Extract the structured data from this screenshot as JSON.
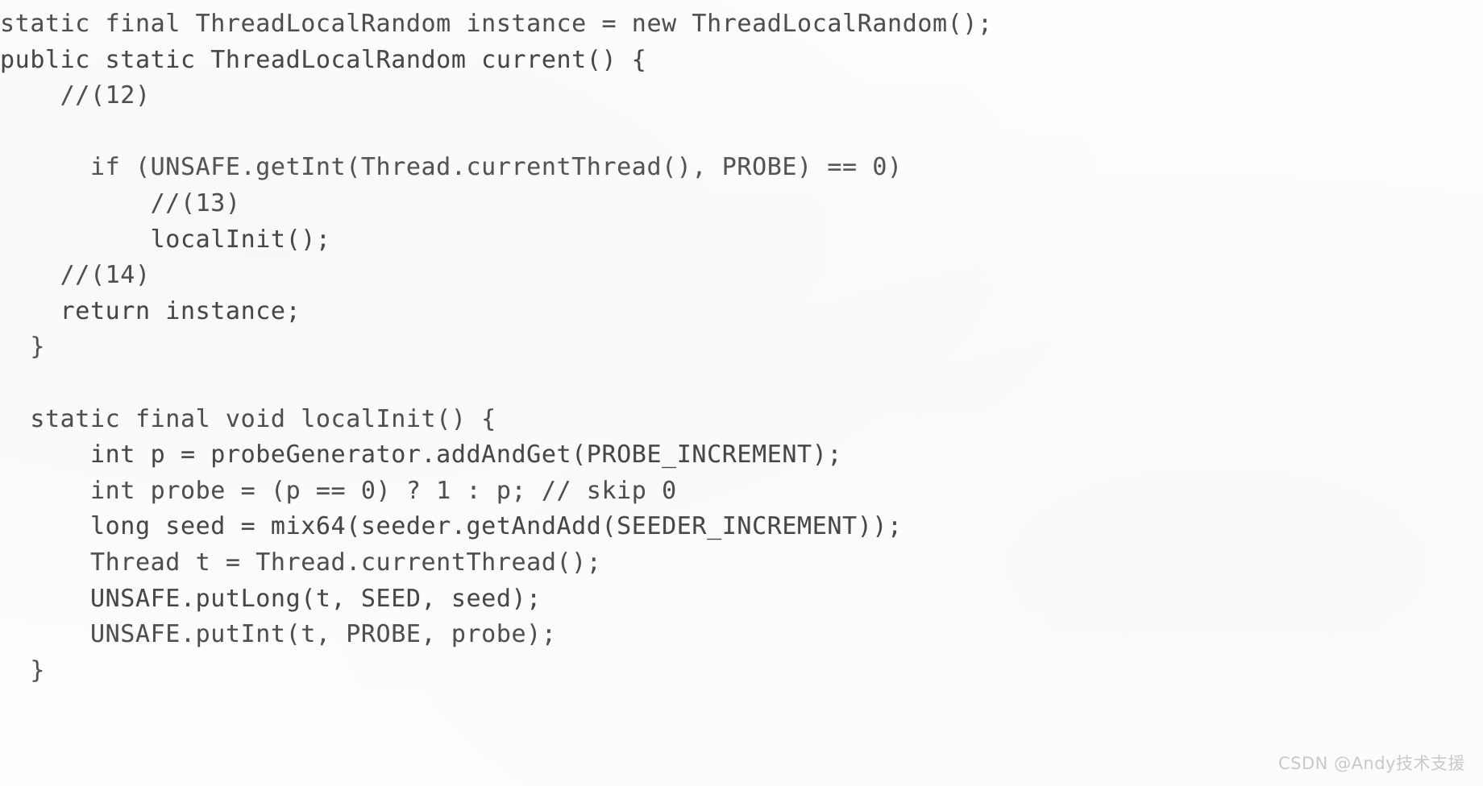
{
  "document": {
    "kind": "scanned-code-listing",
    "language": "Java",
    "background_color": "#fdfdfd",
    "text_color": "#4a4a4a",
    "lines": [
      "static final ThreadLocalRandom instance = new ThreadLocalRandom();",
      "public static ThreadLocalRandom current() {",
      "    //(12)",
      "",
      "      if (UNSAFE.getInt(Thread.currentThread(), PROBE) == 0)",
      "          //(13)",
      "          localInit();",
      "    //(14)",
      "    return instance;",
      "  }",
      "",
      "  static final void localInit() {",
      "      int p = probeGenerator.addAndGet(PROBE_INCREMENT);",
      "      int probe = (p == 0) ? 1 : p; // skip 0",
      "      long seed = mix64(seeder.getAndAdd(SEEDER_INCREMENT));",
      "      Thread t = Thread.currentThread();",
      "      UNSAFE.putLong(t, SEED, seed);",
      "      UNSAFE.putInt(t, PROBE, probe);",
      "  }"
    ]
  },
  "watermark": {
    "text": "CSDN @Andy技术支援",
    "color": "#c9c9c9"
  }
}
